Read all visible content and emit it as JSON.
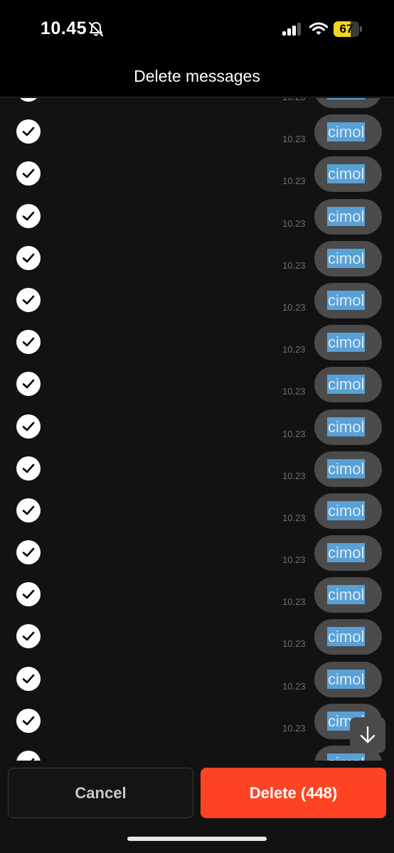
{
  "status_bar": {
    "time": "10.45",
    "battery_percent": 67,
    "battery_label": "67",
    "icons": [
      "bell-muted-icon",
      "signal-icon",
      "wifi-icon",
      "battery-icon"
    ]
  },
  "header": {
    "title": "Delete messages"
  },
  "messages": [
    {
      "text": "cimol",
      "time": "10.23",
      "selected": true
    },
    {
      "text": "cimol",
      "time": "10.23",
      "selected": true
    },
    {
      "text": "cimol",
      "time": "10.23",
      "selected": true
    },
    {
      "text": "cimol",
      "time": "10.23",
      "selected": true
    },
    {
      "text": "cimol",
      "time": "10.23",
      "selected": true
    },
    {
      "text": "cimol",
      "time": "10.23",
      "selected": true
    },
    {
      "text": "cimol",
      "time": "10.23",
      "selected": true
    },
    {
      "text": "cimol",
      "time": "10.23",
      "selected": true
    },
    {
      "text": "cimol",
      "time": "10.23",
      "selected": true
    },
    {
      "text": "cimol",
      "time": "10.23",
      "selected": true
    },
    {
      "text": "cimol",
      "time": "10.23",
      "selected": true
    },
    {
      "text": "cimol",
      "time": "10.23",
      "selected": true
    },
    {
      "text": "cimol",
      "time": "10.23",
      "selected": true
    },
    {
      "text": "cimol",
      "time": "10.23",
      "selected": true
    },
    {
      "text": "cimol",
      "time": "10.23",
      "selected": true
    },
    {
      "text": "cimol",
      "time": "10.23",
      "selected": true
    },
    {
      "text": "cimol",
      "time": "10.23",
      "selected": true
    },
    {
      "text": "cimol",
      "time": "10.23",
      "selected": true
    }
  ],
  "footer": {
    "cancel_label": "Cancel",
    "delete_label": "Delete (448)"
  },
  "colors": {
    "background": "#121212",
    "bubble": "#4b4b4b",
    "text_highlight": "#58a1d6",
    "delete_accent": "#ff4423",
    "battery_fill": "#f4d51e"
  }
}
